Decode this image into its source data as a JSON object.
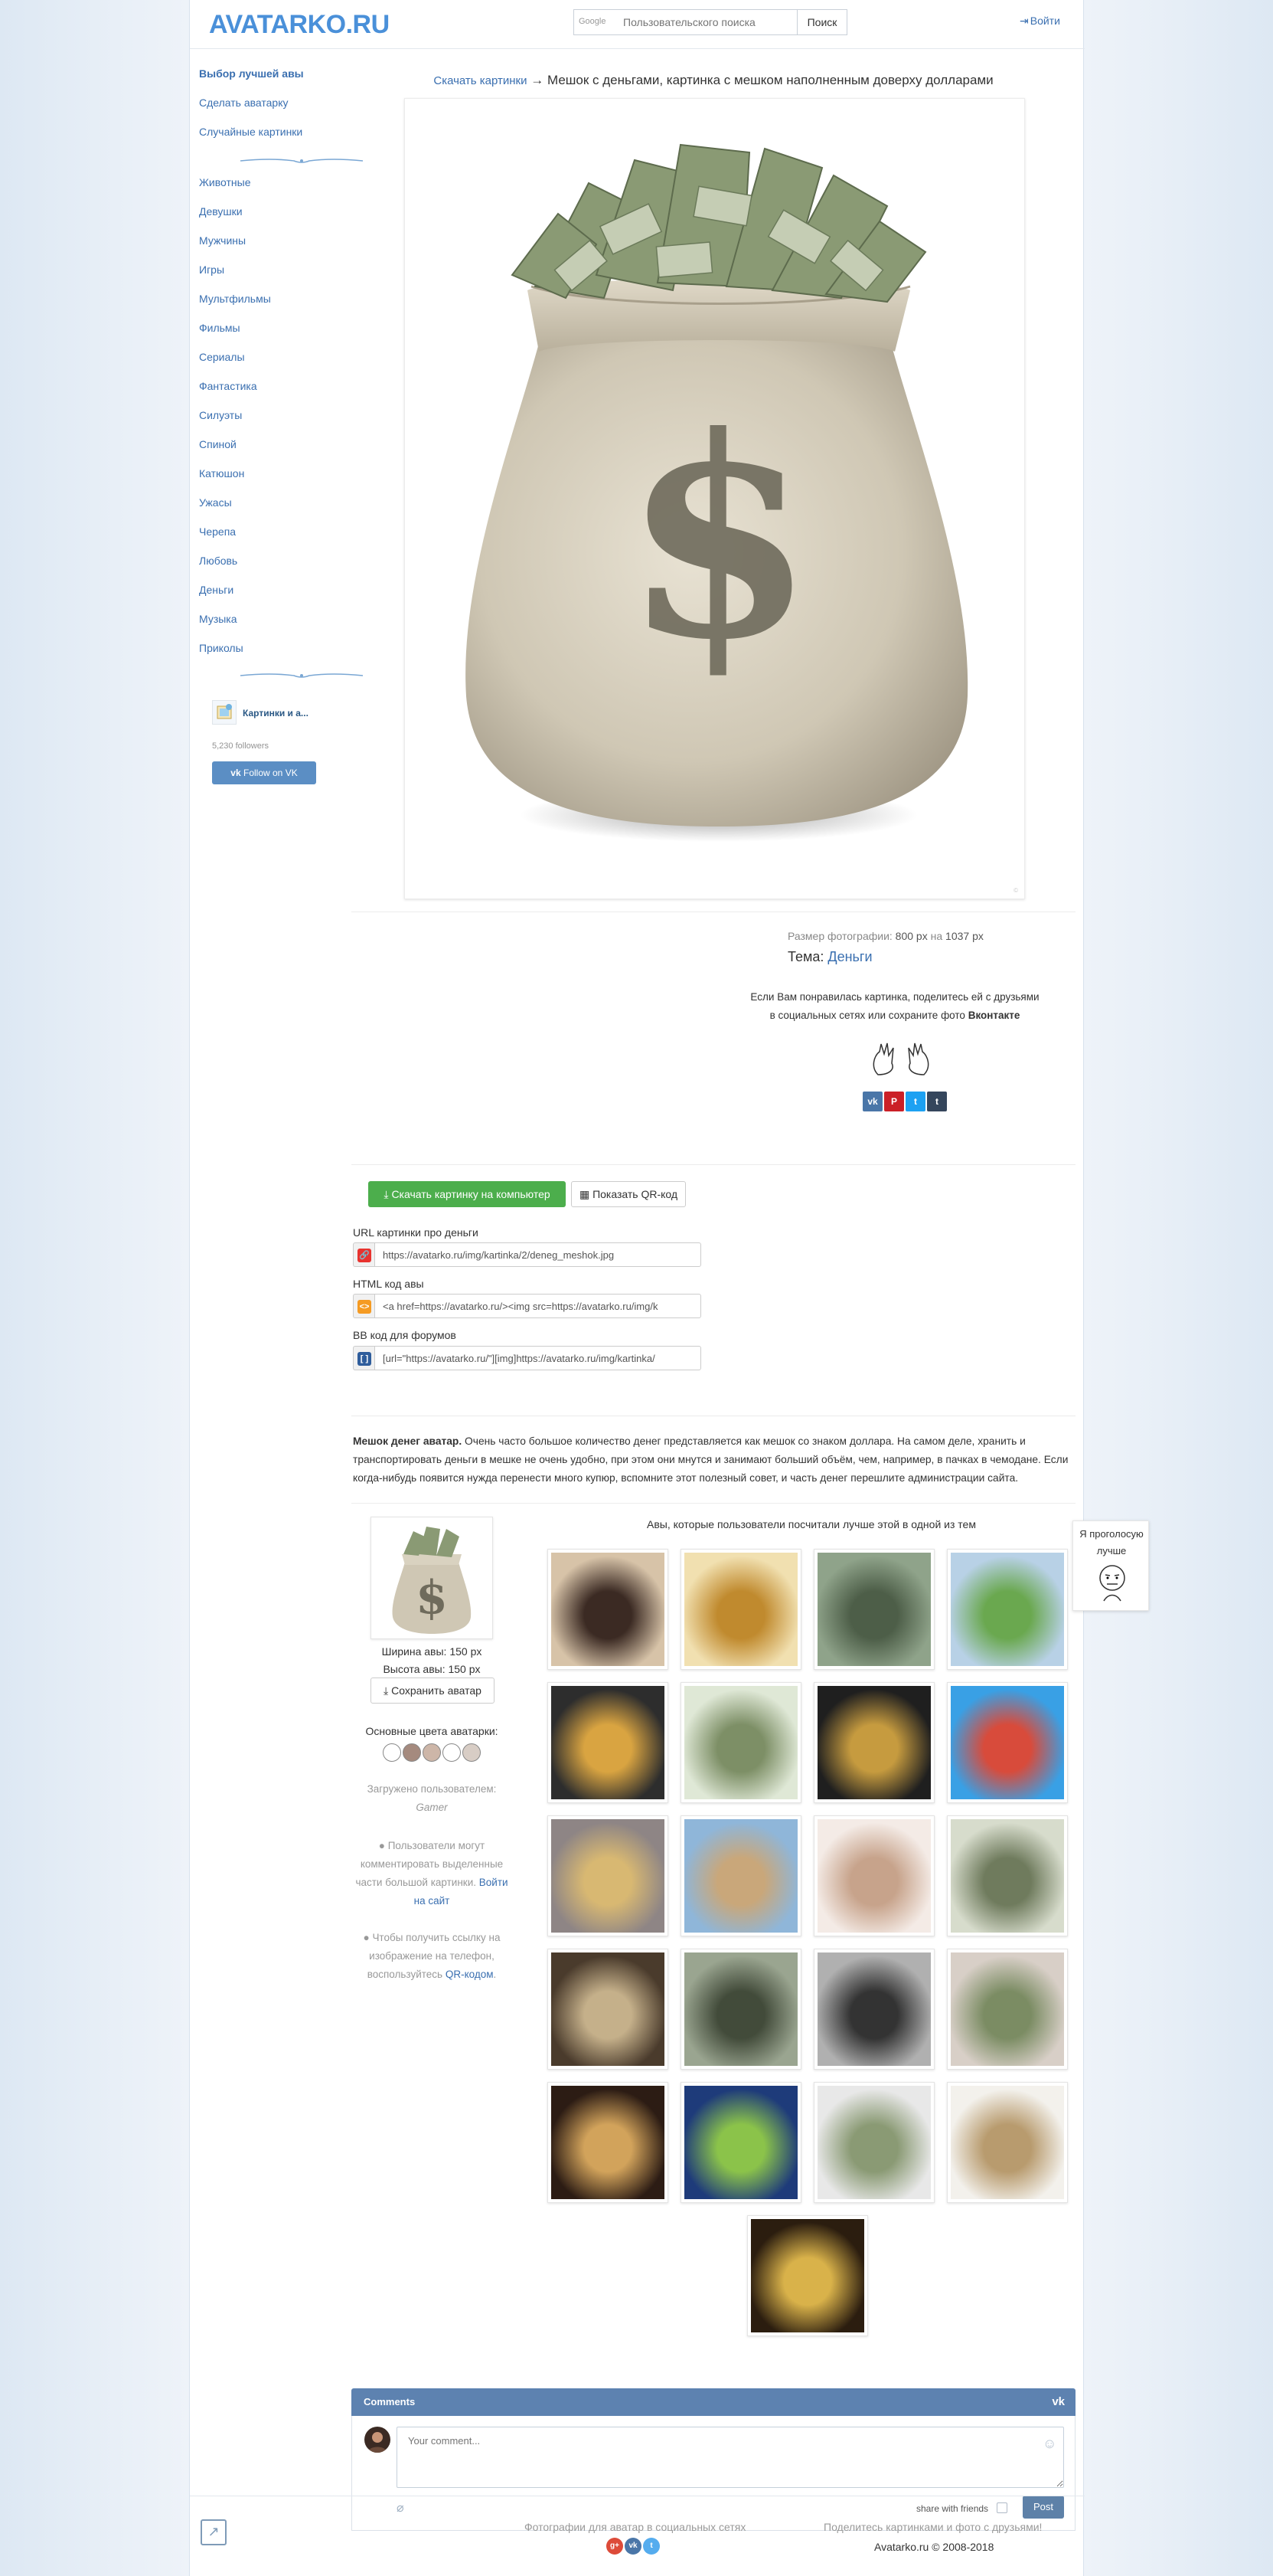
{
  "header": {
    "logo": "AVATARKO.RU",
    "search_placeholder": "Пользовательского поиска",
    "google_label": "Google",
    "search_button": "Поиск",
    "login": "Войти"
  },
  "sidebar": {
    "top_links": [
      "Выбор лучшей авы",
      "Сделать аватарку",
      "Случайные картинки"
    ],
    "categories": [
      "Животные",
      "Девушки",
      "Мужчины",
      "Игры",
      "Мультфильмы",
      "Фильмы",
      "Сериалы",
      "Фантастика",
      "Силуэты",
      "Спиной",
      "Катюшон",
      "Ужасы",
      "Черепа",
      "Любовь",
      "Деньги",
      "Музыка",
      "Приколы"
    ],
    "vk_widget": {
      "group_name": "Картинки и а...",
      "followers": "5,230 followers",
      "follow_button": "Follow on VK"
    }
  },
  "main": {
    "breadcrumb_link": "Скачать картинки",
    "breadcrumb_arrow": "→",
    "title": "Мешок с деньгами, картинка с мешком наполненным доверху долларами",
    "photo_size_prefix": "Размер фотографии:",
    "photo_width": "800 px",
    "photo_size_mid": "на",
    "photo_height": "1037 px",
    "theme_label": "Тема:",
    "theme_value": "Деньги",
    "share_text_1": "Если Вам понравилась картинка, поделитесь ей с друзьями в социальных сетях или сохраните фото",
    "share_text_vk": "Вконтакте",
    "share_buttons": [
      "vk",
      "P",
      "t",
      "t"
    ],
    "download_button": "Скачать картинку на компьютер",
    "qr_button": "Показать QR-код",
    "url_label": "URL картинки про деньги",
    "url_value": "https://avatarko.ru/img/kartinka/2/deneg_meshok.jpg",
    "html_label": "HTML код авы",
    "html_value": "<a href=https://avatarko.ru/><img src=https://avatarko.ru/img/k",
    "bb_label": "BB код для форумов",
    "bb_value": "[url=\"https://avatarko.ru/\"][img]https://avatarko.ru/img/kartinka/",
    "desc_bold": "Мешок денег аватар.",
    "desc_text": "Очень часто большое количество денег представляется как мешок со знаком доллара. На самом деле, хранить и транспортировать деньги в мешке не очень удобно, при этом они мнутся и занимают больший объём, чем, например, в пачках в чемодане. Если когда-нибудь появится нужда перенести много купюр, вспомните этот полезный совет, и часть денег перешлите администрации сайта."
  },
  "avatar_info": {
    "width_line": "Ширина авы: 150 px",
    "height_line": "Высота авы: 150 px",
    "save_button": "Сохранить аватар",
    "colors_label": "Основные цвета аватарки:",
    "colors": [
      "#ffffff",
      "#a58a7e",
      "#cdb6a8",
      "#ffffff",
      "#d8cdc5"
    ],
    "uploaded_label": "Загружено пользователем:",
    "uploaded_user": "Gamer",
    "comments_note": "Пользователи могут комментировать выделенные части большой картинки.",
    "comments_link": "Войти на сайт",
    "qr_note": "Чтобы получить ссылку на изображение на телефон, воспользуйтесь",
    "qr_link": "QR-кодом",
    "qr_note_end": "."
  },
  "similar": {
    "title": "Авы, которые пользователи посчитали лучше этой в одной из тем",
    "tiles": [
      "girl-in-money-icon",
      "coin-stacks-icon",
      "dollar-bills-icon",
      "coins-sprout-icon",
      "coin-tie-icon",
      "dollar-stairs-icon",
      "bitcoin-coin-icon",
      "cartoon-bird-icon",
      "falling-coins-icon",
      "money-hands-clouds-icon",
      "hand-with-bills-icon",
      "money-pile-icon",
      "gun-and-cash-icon",
      "money-tunnel-icon",
      "man-in-money-rain-icon",
      "woman-fanning-bills-icon",
      "bitcoin-dark-icon",
      "dollar-plant-icon",
      "hand-holding-bills-icon",
      "money-bag-icon",
      "golden-coins-icon"
    ]
  },
  "comments": {
    "title": "Comments",
    "placeholder": "Your comment...",
    "share_with_friends": "share with friends",
    "post_button": "Post"
  },
  "footer": {
    "left_text": "Фотографии для аватар в социальных сетях",
    "right_text": "Поделитесь картинками и фото с друзьями!",
    "copyright": "Avatarko.ru © 2008-2018"
  },
  "side_widget": {
    "text": "Я проголосую лучше"
  },
  "colors": {
    "link": "#3a6fb0",
    "logo": "#4a90d9",
    "download_green": "#4cae4c",
    "vk_blue": "#5d82b0"
  }
}
